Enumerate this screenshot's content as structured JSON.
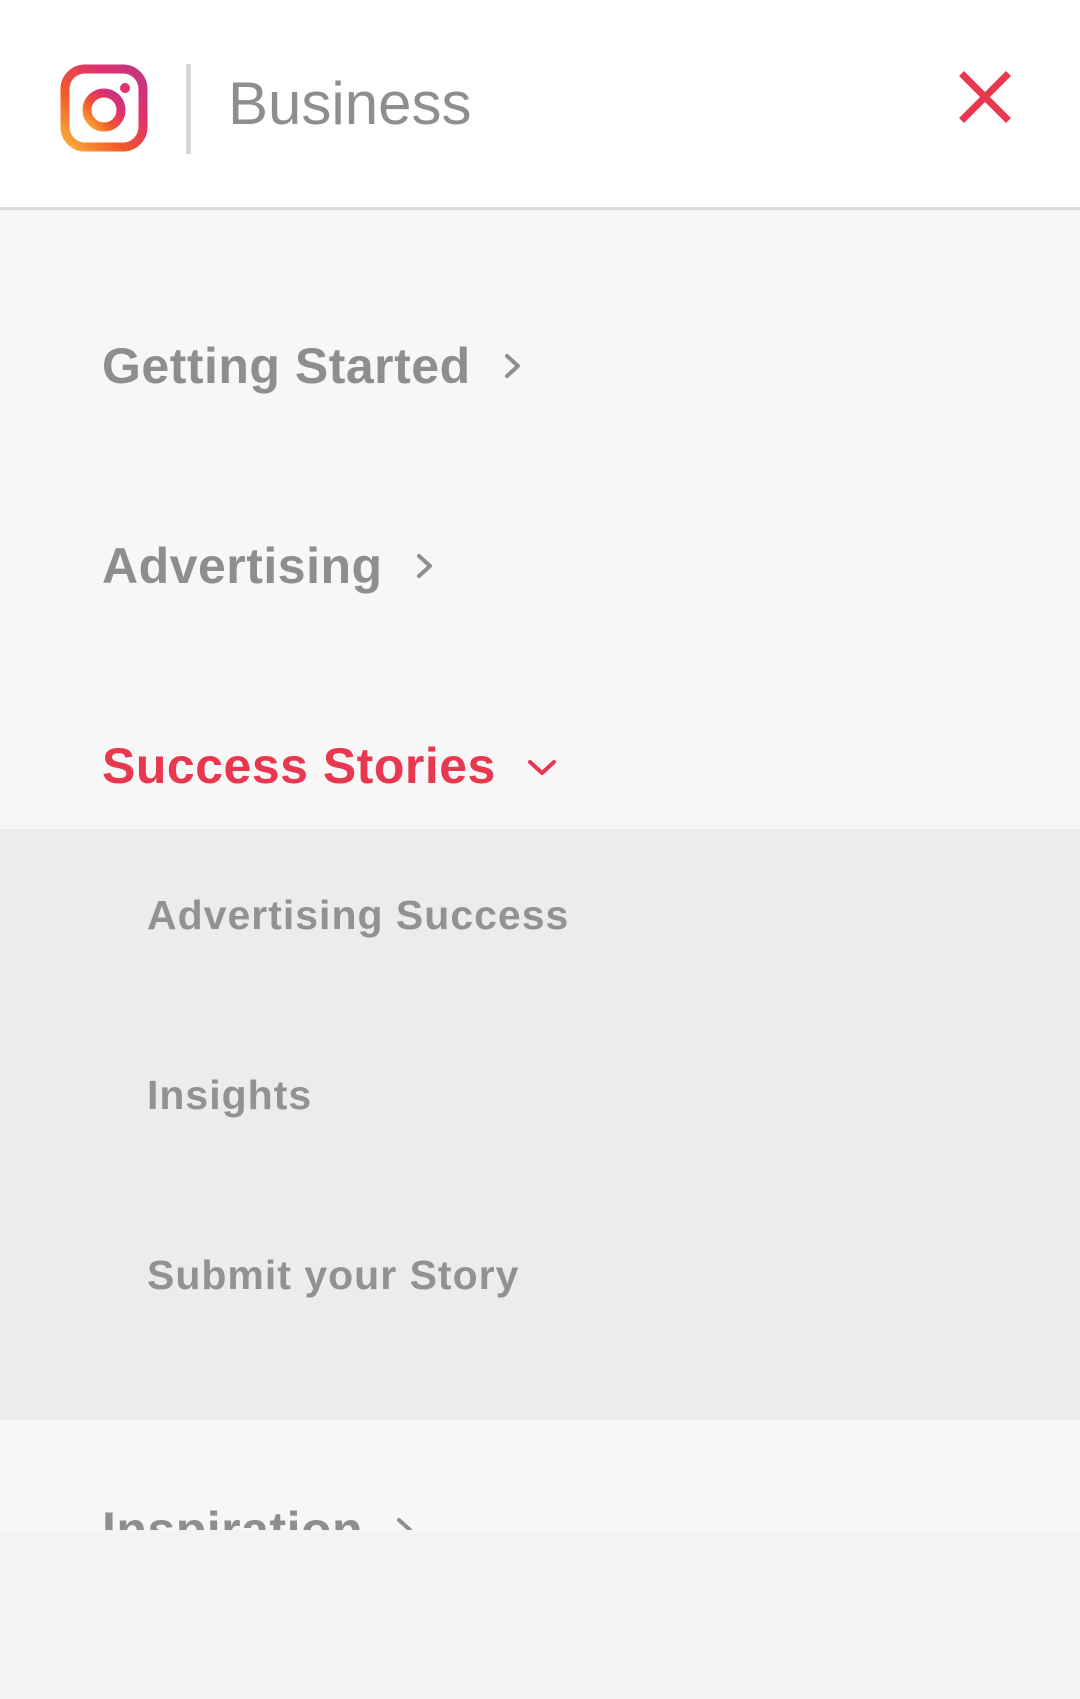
{
  "header": {
    "brand_label": "Business",
    "logo_icon": "instagram-logo-icon",
    "close_icon": "close-icon",
    "colors": {
      "close": "#e8374f",
      "logo_gradient": [
        "#fbb03b",
        "#f15a29",
        "#e1306c",
        "#c13584"
      ]
    }
  },
  "menu": {
    "items": [
      {
        "label": "Getting Started",
        "icon": "chevron-right-icon"
      },
      {
        "label": "Advertising",
        "icon": "chevron-right-icon"
      },
      {
        "label": "Success Stories",
        "icon": "chevron-down-icon",
        "expanded": true
      },
      {
        "label": "Inspiration",
        "icon": "chevron-right-icon"
      }
    ],
    "submenu": [
      {
        "label": "Advertising Success"
      },
      {
        "label": "Insights"
      },
      {
        "label": "Submit your Story"
      }
    ],
    "colors": {
      "active": "#e8374f",
      "inactive": "#8e8e8e",
      "submenu_bg": "#ebecee",
      "menu_bg": "#f7f7f7"
    }
  }
}
